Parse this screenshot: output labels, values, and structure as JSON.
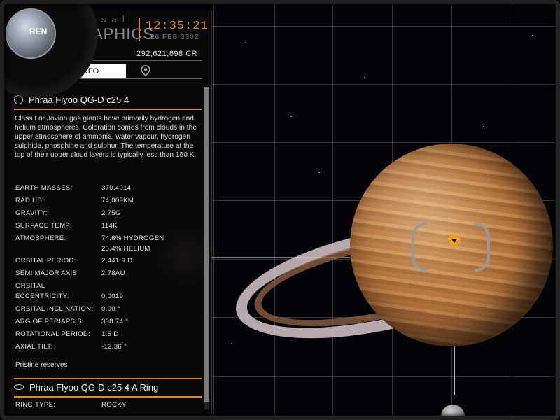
{
  "hud": {
    "app_sub": "sal",
    "app_title": "APHICS",
    "clock": "12:35:21",
    "date": "26 FEB 3302",
    "credits": "292,621,698 CR",
    "logo_text": "REN"
  },
  "tabs": {
    "info_label": "INFO",
    "map_icon": "map-pin-icon"
  },
  "body": {
    "name": "Phraa Flyoo QG-D c25 4",
    "description": "Class I or Jovian gas giants have primarily hydrogen and helium atmospheres. Coloration comes from clouds in the upper atmosphere of ammonia, water vapour, hydrogen sulphide, phosphine and sulphur. The temperature at the top of their upper cloud layers is typically less than 150 K.",
    "stats": [
      {
        "label": "EARTH MASSES:",
        "value": "370.4014"
      },
      {
        "label": "RADIUS:",
        "value": "74,009KM"
      },
      {
        "label": "GRAVITY:",
        "value": "2.75G"
      },
      {
        "label": "SURFACE TEMP:",
        "value": "114K"
      },
      {
        "label": "ATMOSPHERE:",
        "value": "74.6% HYDROGEN",
        "value2": "25.4% HELIUM"
      },
      {
        "label": "ORBITAL PERIOD:",
        "value": "2,441.9 D"
      },
      {
        "label": "SEMI MAJOR AXIS:",
        "value": "2.78AU"
      },
      {
        "label": "ORBITAL",
        "label2": "ECCENTRICITY:",
        "value": "0.0019"
      },
      {
        "label": "ORBITAL INCLINATION:",
        "value": "0.00 °"
      },
      {
        "label": "ARG OF PERIAPSIS:",
        "value": "338.74 °"
      },
      {
        "label": "ROTATIONAL PERIOD:",
        "value": "1.5 D"
      },
      {
        "label": "AXIAL TILT:",
        "value": "-12.36 °"
      }
    ],
    "reserves": "Pristine reserves"
  },
  "ring": {
    "name": "Phraa Flyoo QG-D c25 4 A Ring",
    "type_label": "RING TYPE:",
    "type_value": "ROCKY"
  },
  "colors": {
    "accent": "#e08a1e",
    "marker": "#f0a020"
  }
}
